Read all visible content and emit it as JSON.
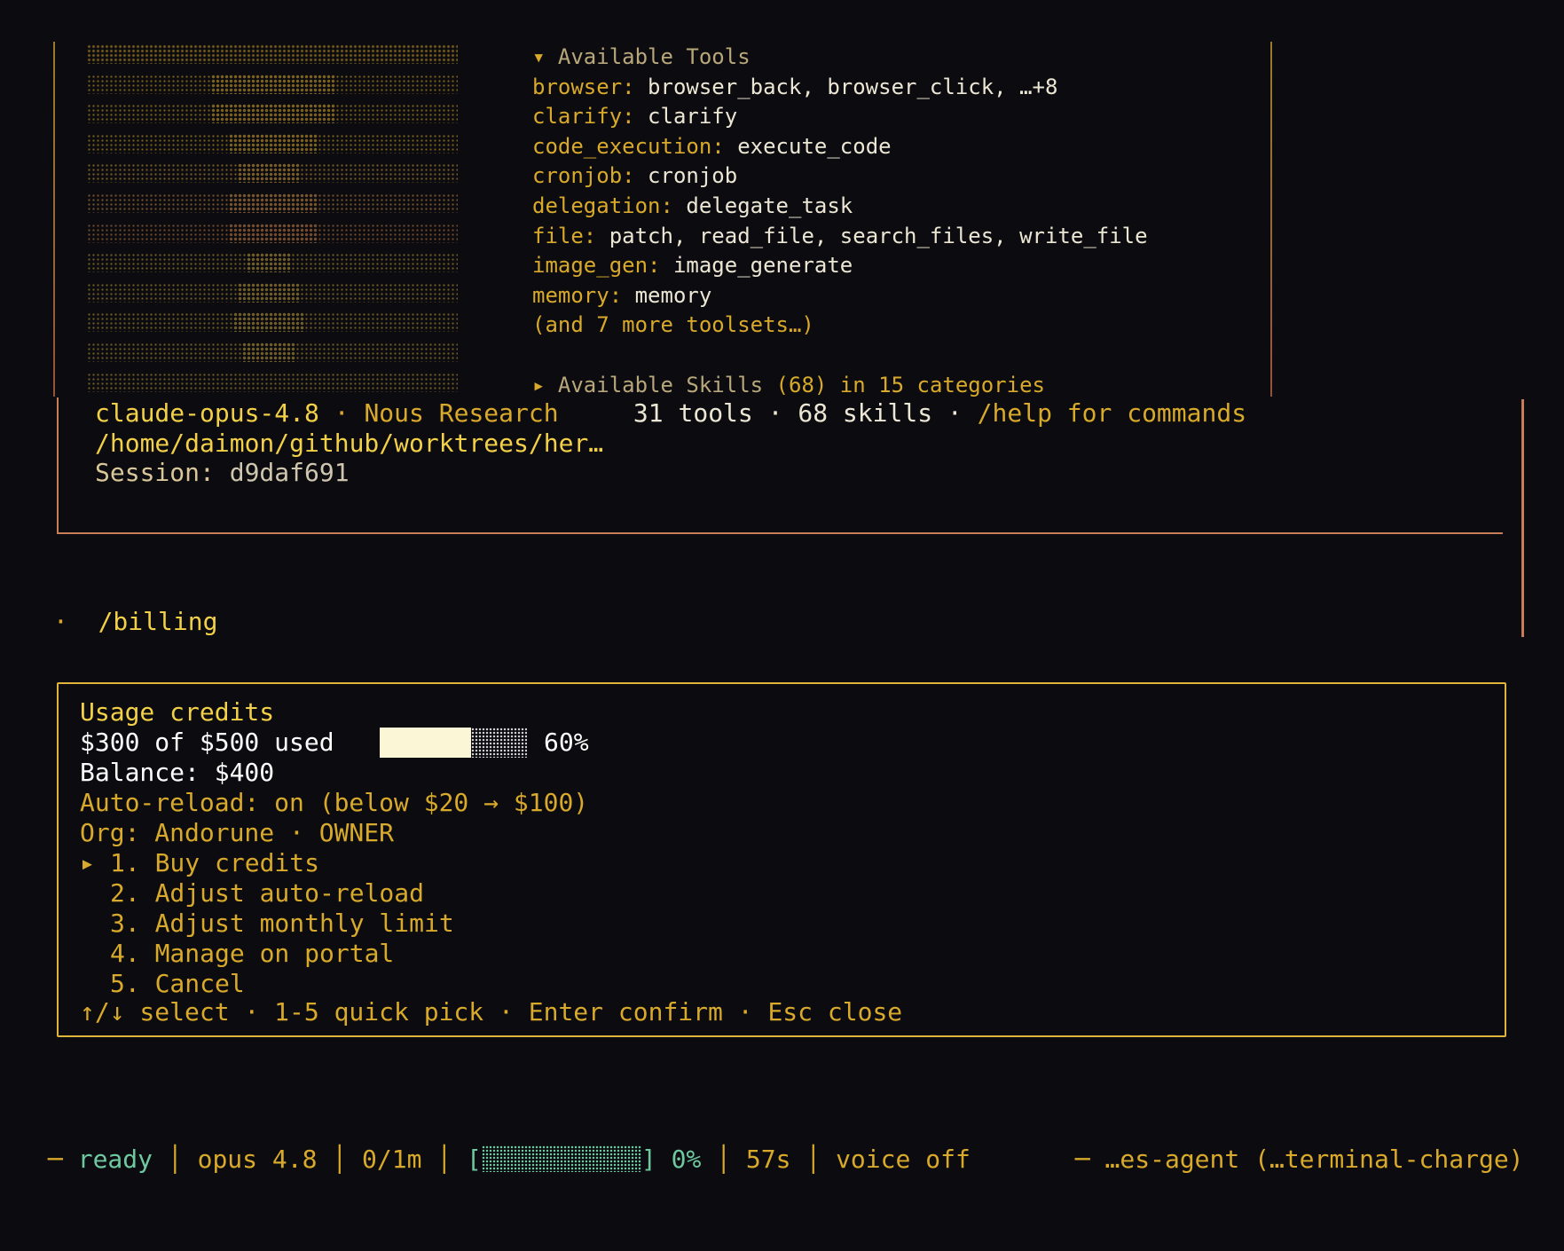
{
  "tools_panel": {
    "header_tools": "Available Tools",
    "categories": [
      {
        "key": "browser:",
        "value": "browser_back, browser_click, …+8"
      },
      {
        "key": "clarify:",
        "value": "clarify"
      },
      {
        "key": "code_execution:",
        "value": "execute_code"
      },
      {
        "key": "cronjob:",
        "value": "cronjob"
      },
      {
        "key": "delegation:",
        "value": "delegate_task"
      },
      {
        "key": "file:",
        "value": "patch, read_file, search_files, write_file"
      },
      {
        "key": "image_gen:",
        "value": "image_generate"
      },
      {
        "key": "memory:",
        "value": "memory"
      }
    ],
    "more": "(and 7 more toolsets…)",
    "skills_header": "Available Skills",
    "skills_suffix": "(68) in 15 categories"
  },
  "session": {
    "model": "claude-opus-4.8",
    "provider": "· Nous Research",
    "counts": "31 tools · 68 skills ·",
    "help": "/help for commands",
    "path": "/home/daimon/github/worktrees/her…",
    "session_label": "Session:",
    "session_id": "d9daf691"
  },
  "command": {
    "bullet": "·",
    "text": "/billing"
  },
  "billing": {
    "title": "Usage credits",
    "used_text": "$300 of $500 used",
    "used_fraction": 0.6,
    "percent": "60%",
    "balance": "Balance: $400",
    "auto_reload": "Auto-reload: on (below $20 → $100)",
    "org": "Org: Andorune · OWNER",
    "selected_marker": "▸",
    "options": [
      "1. Buy credits",
      "2. Adjust auto-reload",
      "3. Adjust monthly limit",
      "4. Manage on portal",
      "5. Cancel"
    ],
    "hint": "↑/↓ select · 1-5 quick pick · Enter confirm · Esc close"
  },
  "statusbar": {
    "dash": "─",
    "state": "ready",
    "model": "opus 4.8",
    "tokens": "0/1m",
    "context_fraction": 0,
    "context_pct": "0%",
    "elapsed": "57s",
    "voice": "voice off",
    "branch": "─ …es-agent (…terminal-charge)"
  },
  "colors": {
    "accent": "#d8a92a",
    "border_copper": "#c77e58",
    "ready": "#6ec9a0",
    "background": "#0c0c10"
  }
}
